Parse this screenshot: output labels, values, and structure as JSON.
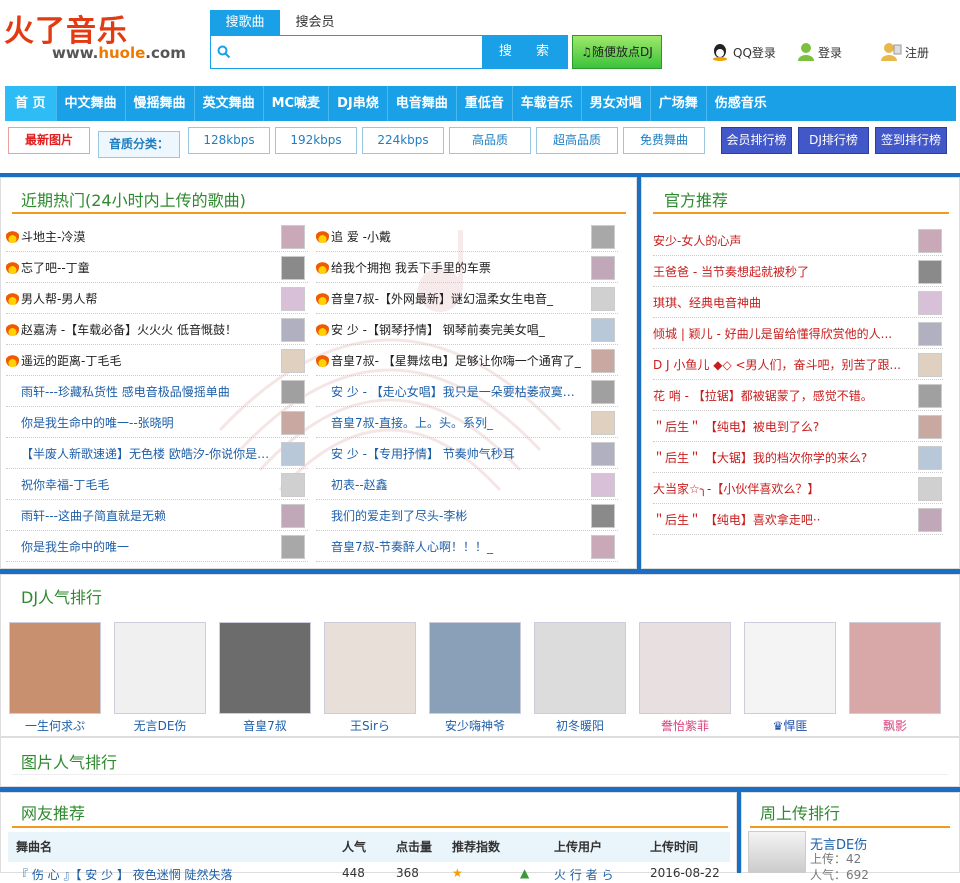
{
  "logo": {
    "main": "火了音乐",
    "url_pre": "www.",
    "url_mid": "huole",
    "url_post": ".com"
  },
  "search": {
    "tab_active": "搜歌曲",
    "tab_other": "搜会员",
    "button": "搜 索",
    "dj_button": "随便放点DJ"
  },
  "auth": {
    "qq": "QQ登录",
    "login": "登录",
    "register": "注册"
  },
  "nav": [
    "首 页",
    "中文舞曲",
    "慢摇舞曲",
    "英文舞曲",
    "MC喊麦",
    "DJ串烧",
    "电音舞曲",
    "重低音",
    "车载音乐",
    "男女对唱",
    "广场舞",
    "伤感音乐"
  ],
  "subnav": {
    "latest": "最新图片",
    "quality_label": "音质分类：",
    "qualities": [
      "128kbps",
      "192kbps",
      "224kbps",
      "高品质",
      "超高品质",
      "免费舞曲"
    ],
    "ranks": [
      "会员排行榜",
      "DJ排行榜",
      "签到排行榜"
    ]
  },
  "hot": {
    "title": "近期热门(24小时内上传的歌曲)",
    "left": [
      "斗地主-冷漠",
      "忘了吧--丁童",
      "男人帮-男人帮",
      "赵嘉涛 -【车载必备】火火火 低音慨鼓！",
      "遥远的距离-丁毛毛",
      "雨轩---珍藏私货性 感电音极品慢摇单曲",
      "你是我生命中的唯一--张晓明",
      "【半废人新歌速递】无色楼 欧皓汐-你说你是真...",
      "祝你幸福-丁毛毛",
      "雨轩---这曲子简直就是无赖",
      "你是我生命中的唯一"
    ],
    "right": [
      "追 爱 -小戴",
      "给我个拥抱 我丢下手里的车票",
      "音皇7叔-【外网最新】谜幻温柔女生电音_",
      "安 少 -【钢琴抒情】 钢琴前奏完美女唱_",
      "音皇7叔-   【星舞炫电】足够让你嗨一个通宵了_",
      "安 少 - 【走心女唱】我只是一朵要枯萎寂寞的...",
      "音皇7叔-直接。上。头。系列_",
      "安 少 -【专用抒情】 节奏帅气秒耳",
      "初表--赵鑫",
      "我们的爱走到了尽头-李彬",
      "音皇7叔-节奏醉人心啊！！！_"
    ]
  },
  "official": {
    "title": "官方推荐",
    "items": [
      "安少-女人的心声",
      "王爸爸 - 当节奏想起就被秒了",
      "琪琪、经典电音神曲",
      "倾城 | 颖儿   -    好曲儿是留给懂得欣赏他的人...",
      "D J 小鱼儿 ◆◇ <男人们，奋斗吧，别苦了跟...",
      "花   哨   -   【拉锯】都被锯蒙了，感觉不错。",
      "＂后生＂    【纯电】被电到了么?",
      "＂后生＂    【大锯】我的档次你学的来么?",
      "大当家☆╮-【小伙伴喜欢么？】",
      "＂后生＂    【纯电】喜欢拿走吧··"
    ]
  },
  "dj_rank": {
    "title": "DJ人气排行",
    "names": [
      "一生何求ぷ",
      "无言DE伤",
      "音皇7叔",
      "王Sirら",
      "安少嗨神爷",
      "初冬暖阳",
      "誊怡紫菲",
      "♛悍匪",
      "飘影"
    ]
  },
  "pic_rank": {
    "title": "图片人气排行"
  },
  "friends": {
    "title": "网友推荐",
    "headers": [
      "舞曲名",
      "人气",
      "点击量",
      "推荐指数",
      "上传用户",
      "上传时间"
    ],
    "row_partial": "『 伤 心 』【 安 少 】 夜色迷惘 陡然失落",
    "row_num1": "448",
    "row_num2": "368",
    "row_user": "火 行 者 ら",
    "row_time": "2016-08-22"
  },
  "weekly": {
    "title": "周上传排行",
    "name": "无言DE伤",
    "upload_label": "上传：",
    "upload": "42",
    "pop_label": "人气：",
    "pop": "692"
  }
}
